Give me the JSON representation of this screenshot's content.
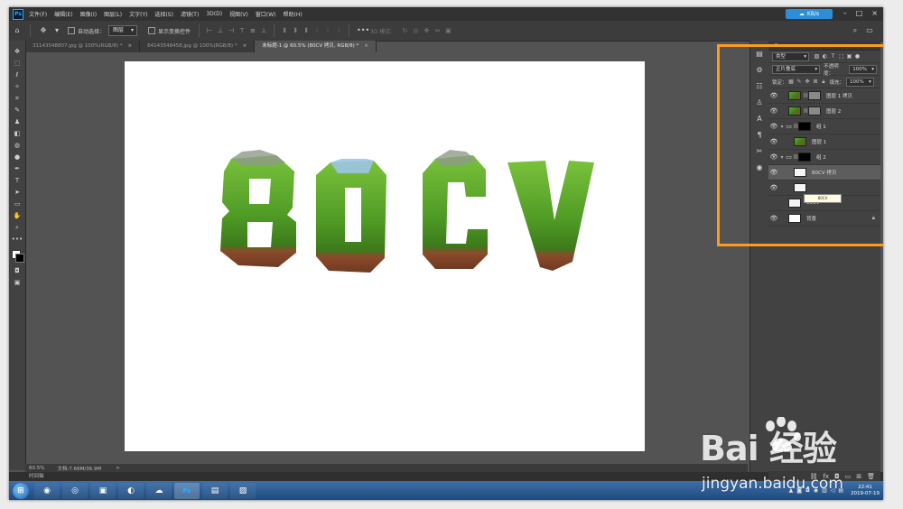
{
  "menubar": {
    "items": [
      "文件(F)",
      "编辑(E)",
      "图像(I)",
      "图层(L)",
      "文字(Y)",
      "选择(S)",
      "滤镜(T)",
      "3D(D)",
      "视图(V)",
      "窗口(W)",
      "帮助(H)"
    ],
    "cloud_badge": "KB/s"
  },
  "options": {
    "auto_select_label": "自动选择：",
    "auto_select_value": "图层",
    "show_transform_label": "显示变换控件",
    "mode_label": "3D 模式："
  },
  "tabs": [
    {
      "label": "31143548807.jpg @ 100%(RGB/8) *",
      "close": "×"
    },
    {
      "label": "64143548458.jpg @ 100%(RGB/8) *",
      "close": "×"
    },
    {
      "label": "未标题-1 @ 60.5% (80CV 拷贝, RGB/8) *",
      "close": "×"
    }
  ],
  "canvas": {
    "text": "80CV",
    "colors": {
      "grass": "#4e9a24",
      "soil": "#8b4a2b",
      "background": "#ffffff"
    }
  },
  "statusbar": {
    "zoom": "60.5%",
    "doc": "文档:7.66M/36.9M",
    "arrow": ">"
  },
  "timeline": {
    "label": "时间轴"
  },
  "layers_panel": {
    "filter_kind": "类型",
    "blend_mode": "正片叠底",
    "opacity_label": "不透明度：",
    "opacity_value": "100%",
    "lock_label": "锁定：",
    "fill_label": "填充：",
    "fill_value": "100%",
    "layers": [
      {
        "name": "图层 1 拷贝",
        "visible": true,
        "thumb": "grass",
        "mask": "gray",
        "selected": false
      },
      {
        "name": "图层 2",
        "visible": true,
        "thumb": "grass",
        "mask": "gray",
        "selected": false
      },
      {
        "name": "组 1",
        "visible": true,
        "thumb": "black",
        "group": true,
        "selected": false
      },
      {
        "name": "图层 1",
        "visible": true,
        "thumb": "grass",
        "indent": true,
        "selected": false
      },
      {
        "name": "组 2",
        "visible": true,
        "thumb": "black",
        "group": true,
        "selected": false
      },
      {
        "name": "80CV 拷贝",
        "visible": true,
        "thumb": "text",
        "indent": true,
        "selected": true
      },
      {
        "name": "",
        "visible": true,
        "thumb": "text",
        "indent": true,
        "selected": false
      },
      {
        "name": "80CV",
        "visible": false,
        "thumb": "text",
        "selected": false
      },
      {
        "name": "背景",
        "visible": true,
        "thumb": "white",
        "locked": true,
        "selected": false
      }
    ],
    "tooltip": "80CV"
  },
  "taskbar": {
    "time": "22:41",
    "date": "2019-07-19"
  },
  "watermark": {
    "logo": "Bai  经验",
    "url": "jingyan.baidu.com"
  },
  "highlight_color": "#ff9a1a"
}
